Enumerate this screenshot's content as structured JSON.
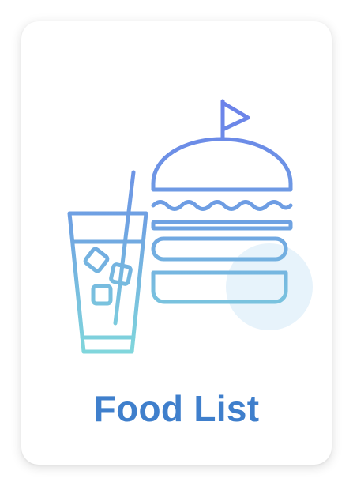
{
  "card": {
    "title": "Food List",
    "icon": "burger-and-drink-icon"
  },
  "colors": {
    "title": "#3f7fcc",
    "icon_gradient_top": "#6c86e8",
    "icon_gradient_bottom": "#7ed4dc",
    "highlight_circle": "#e6f3fb",
    "card_background": "#ffffff"
  }
}
